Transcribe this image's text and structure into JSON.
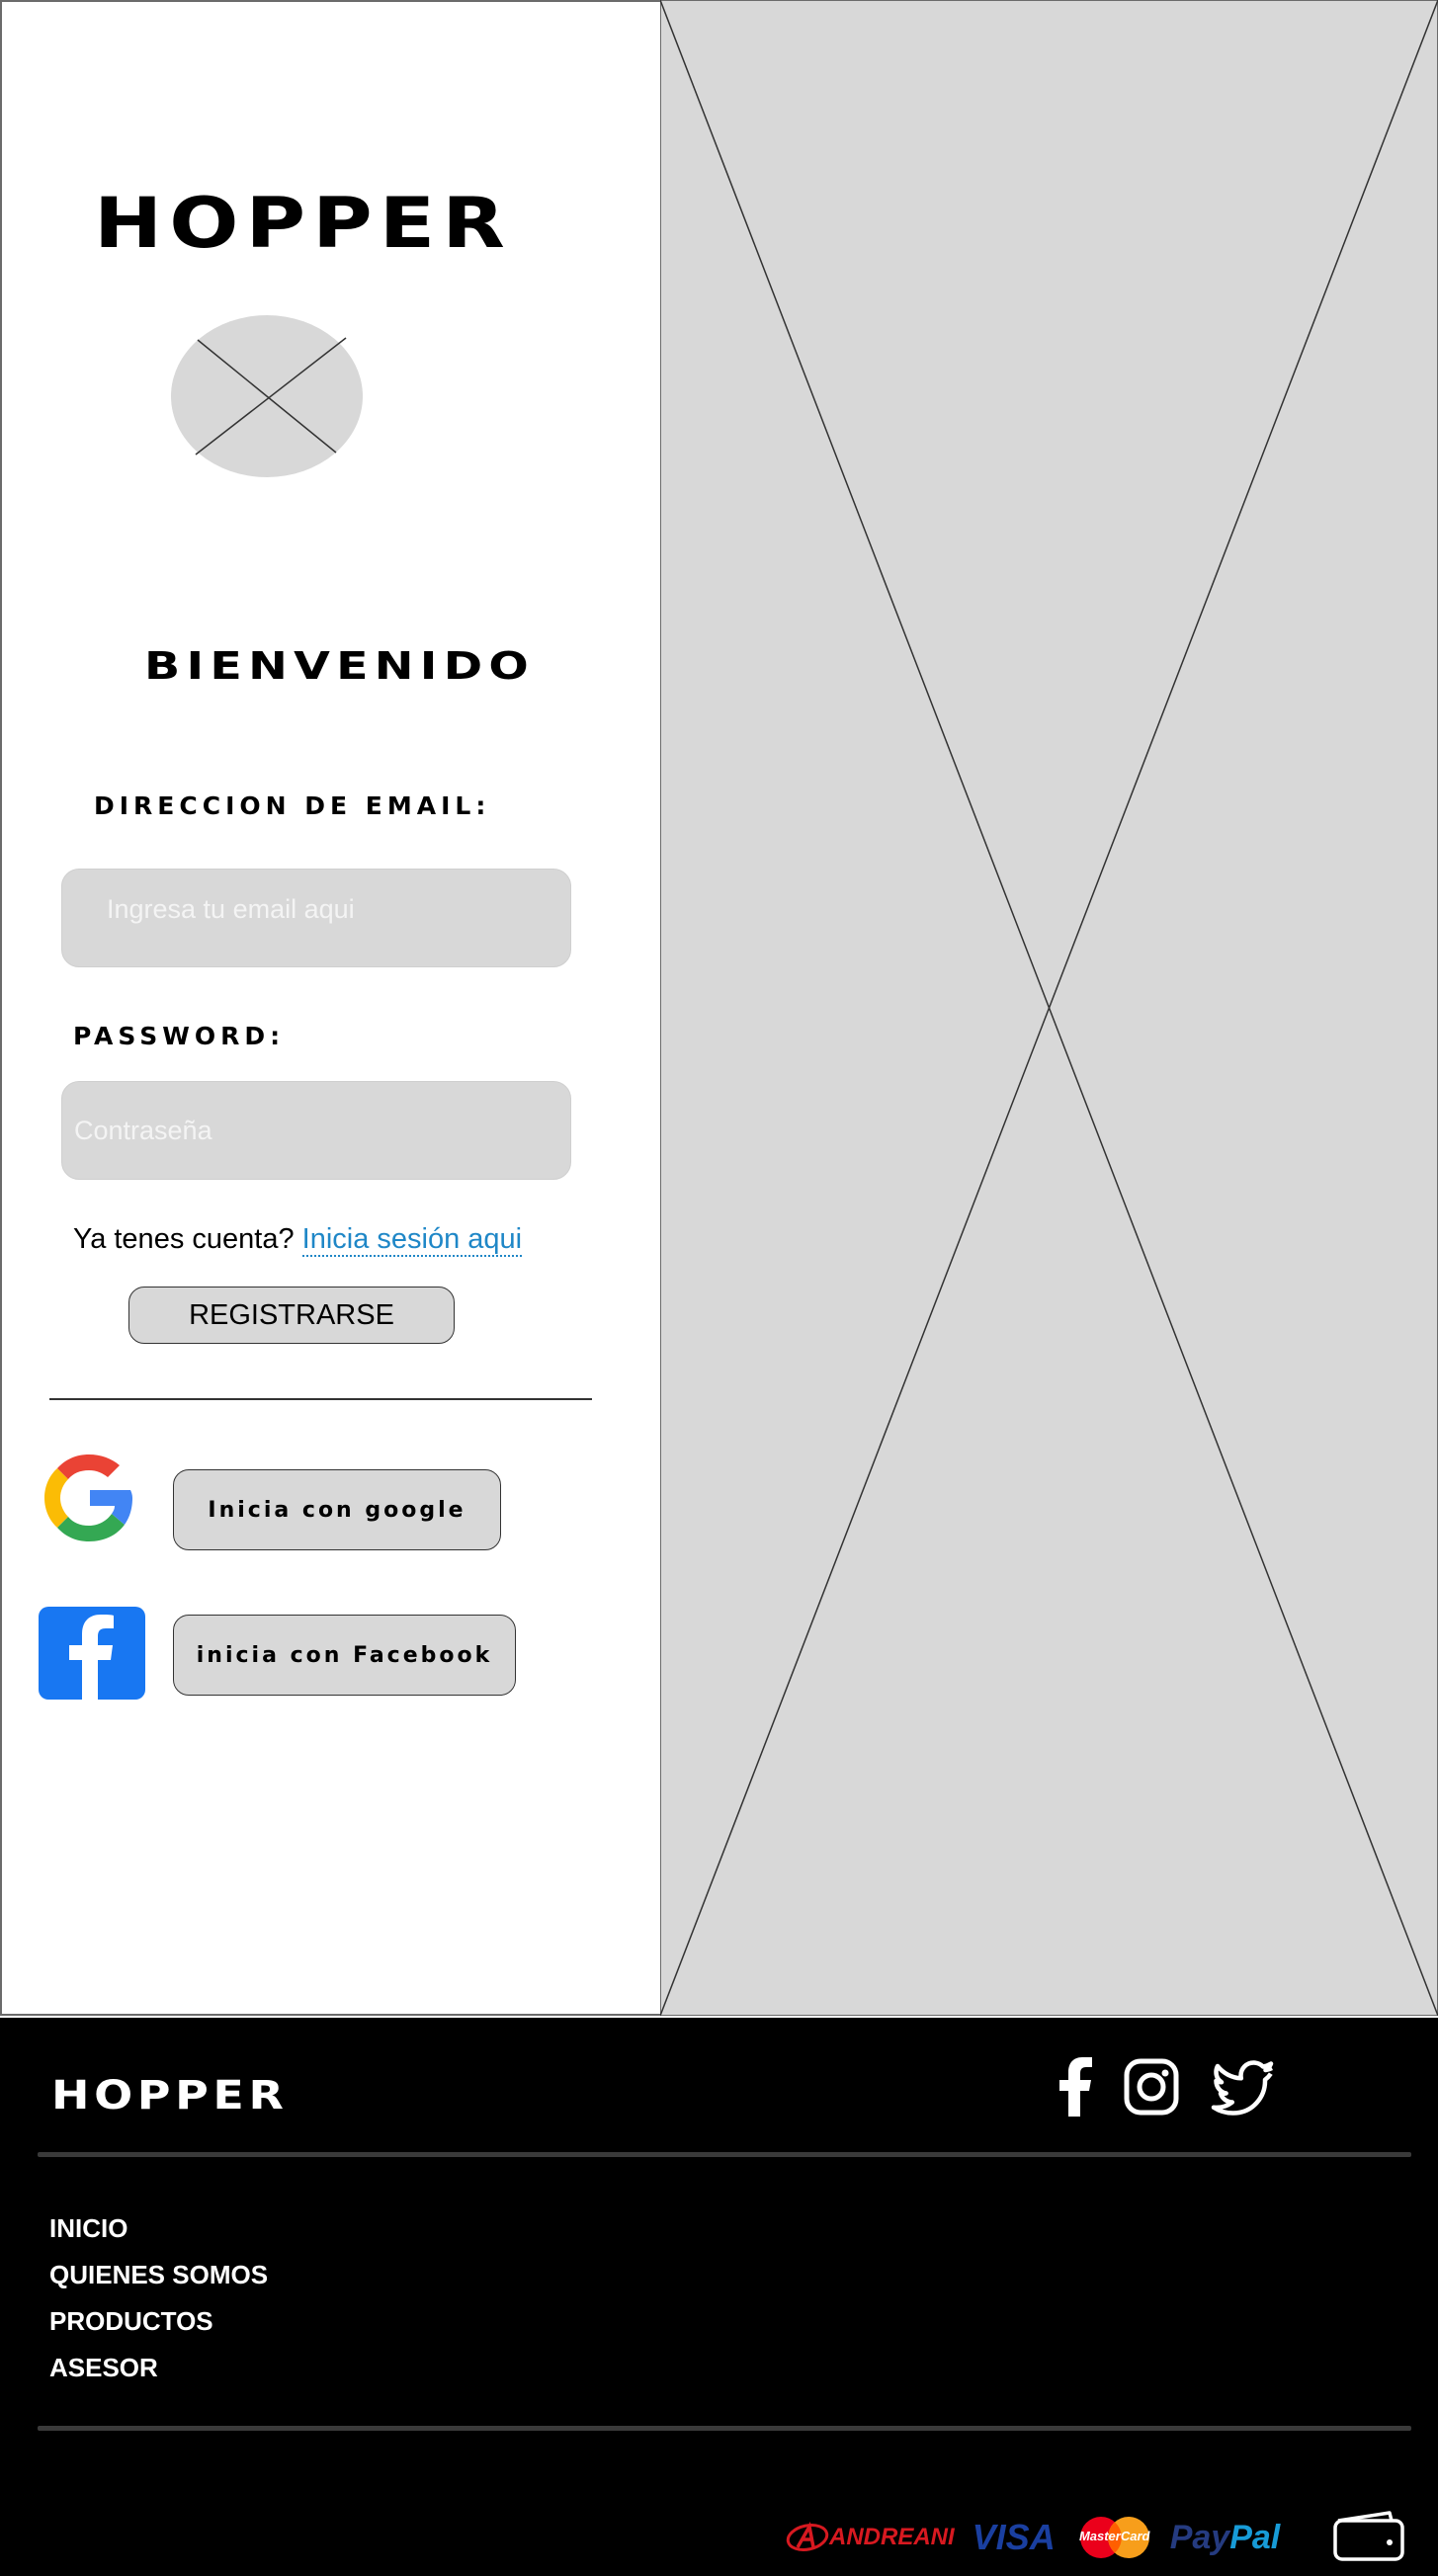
{
  "login": {
    "brand": "HOPPER",
    "welcome": "BIENVENIDO",
    "email_label": "DIRECCION DE EMAIL:",
    "email_placeholder": "Ingresa tu email aqui",
    "password_label": "PASSWORD:",
    "password_placeholder": "Contraseña",
    "account_prompt": "Ya tenes cuenta?",
    "login_link": "Inicia sesión aqui",
    "register_button": "REGISTRARSE",
    "google_button": "Inicia con google",
    "facebook_button": "inicia  con Facebook"
  },
  "footer": {
    "brand": "HOPPER",
    "social_icons": [
      "facebook-icon",
      "instagram-icon",
      "twitter-icon"
    ],
    "nav": [
      "INICIO",
      "QUIENES SOMOS",
      "PRODUCTOS",
      "ASESOR"
    ],
    "payments": {
      "andreani": "ANDREANI",
      "visa": "VISA",
      "mastercard": "MasterCard",
      "paypal_pay": "Pay",
      "paypal_pal": "Pal"
    }
  },
  "colors": {
    "placeholder_gray": "#d8d8d8",
    "link_blue": "#1f87c7",
    "footer_bg": "#000000",
    "facebook_blue": "#1877f2"
  }
}
